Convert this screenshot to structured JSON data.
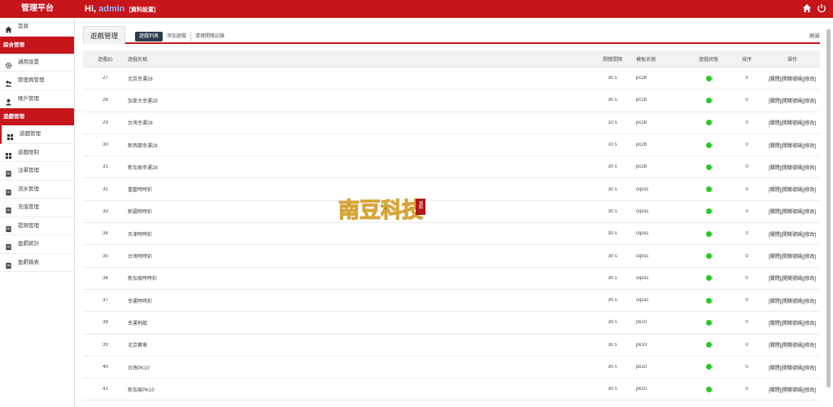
{
  "header": {
    "brand": "管理平台",
    "greeting_hi": "Hi,",
    "username": "admin",
    "profile_link": "[資料設置]"
  },
  "sidebar": {
    "home": "首頁",
    "sections": [
      {
        "title": "綜合管理",
        "items": [
          "通用設置",
          "管理員管理",
          "賬戶管理"
        ]
      },
      {
        "title": "遊戲管理",
        "items": [
          "遊戲管理",
          "遊戲限制",
          "注單管理",
          "流水管理",
          "充值管理",
          "提現管理",
          "盈虧統計",
          "盈虧報表"
        ]
      }
    ]
  },
  "page": {
    "title_tab": "遊戲管理",
    "subtabs": [
      "遊戲列表",
      "添加遊戲",
      "清理開獎記錄"
    ],
    "refresh": "刷新"
  },
  "table": {
    "headers": [
      "遊戲ID",
      "遊戲名稱",
      "開獎間隔",
      "模板名稱",
      "遊戲狀態",
      "排序",
      "操作"
    ],
    "rows": [
      {
        "id": "27",
        "name": "北京幸運28",
        "interval": "30 s",
        "template": "pc28",
        "sort": "0"
      },
      {
        "id": "28",
        "name": "加拿大幸運28",
        "interval": "30 s",
        "template": "pc28",
        "sort": "0"
      },
      {
        "id": "29",
        "name": "台灣幸運28",
        "interval": "10 s",
        "template": "pc28",
        "sort": "0"
      },
      {
        "id": "30",
        "name": "新西蘭幸運28",
        "interval": "10 s",
        "template": "pc28",
        "sort": "0"
      },
      {
        "id": "31",
        "name": "新加坡幸運28",
        "interval": "30 s",
        "template": "pc28",
        "sort": "0"
      },
      {
        "id": "32",
        "name": "重慶時時彩",
        "interval": "30 s",
        "template": "cqssc",
        "sort": "0"
      },
      {
        "id": "33",
        "name": "新疆時時彩",
        "interval": "30 s",
        "template": "cqssc",
        "sort": "0"
      },
      {
        "id": "34",
        "name": "天津時時彩",
        "interval": "30 s",
        "template": "cqssc",
        "sort": "0"
      },
      {
        "id": "35",
        "name": "台灣時時彩",
        "interval": "30 s",
        "template": "cqssc",
        "sort": "0"
      },
      {
        "id": "36",
        "name": "新加坡時時彩",
        "interval": "30 s",
        "template": "cqssc",
        "sort": "0"
      },
      {
        "id": "37",
        "name": "幸運時時彩",
        "interval": "30 s",
        "template": "cqssc",
        "sort": "0"
      },
      {
        "id": "38",
        "name": "幸運飛艇",
        "interval": "30 s",
        "template": "pk10",
        "sort": "0"
      },
      {
        "id": "39",
        "name": "北京賽車",
        "interval": "30 s",
        "template": "pk10",
        "sort": "0"
      },
      {
        "id": "40",
        "name": "台灣PK10",
        "interval": "30 s",
        "template": "pk10",
        "sort": "0"
      },
      {
        "id": "41",
        "name": "新加坡PK10",
        "interval": "30 s",
        "template": "pk10",
        "sort": "0"
      }
    ],
    "ops": {
      "close": "[關閉]",
      "open_number": "[開獎號碼]",
      "edit": "[修改]"
    },
    "status_color": "#22cc22"
  },
  "watermark": {
    "text": "南豆科技",
    "seal": "源码"
  },
  "colors": {
    "brand_red": "#c6151b",
    "subtab_active": "#2d3a4b"
  }
}
